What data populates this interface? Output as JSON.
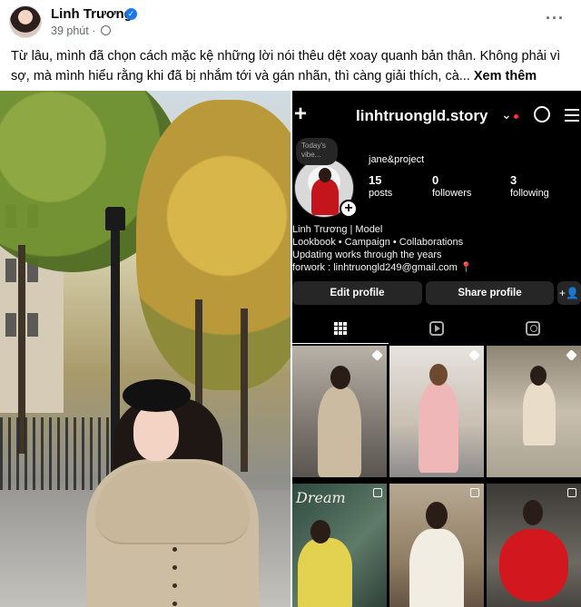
{
  "post": {
    "author": "Linh Trương",
    "verified_icon": "verified-badge-icon",
    "time": "39 phút",
    "dot": "·",
    "more_label": "···",
    "caption": "Từ lâu, mình đã chọn cách mặc kệ những lời nói thêu dệt xoay quanh bản thân. Không phải vì sợ, mà mình hiểu rằng khi đã bị nhắm tới và gán nhãn, thì càng giải thích, cà...",
    "see_more": "Xem thêm"
  },
  "instagram": {
    "username": "linhtruongld.story",
    "chevron": "⌄",
    "note": "Today's vibe...",
    "handle": "jane&project",
    "stats": [
      {
        "value": "15",
        "label": "posts"
      },
      {
        "value": "0",
        "label": "followers"
      },
      {
        "value": "3",
        "label": "following"
      }
    ],
    "bio": {
      "line1": "Linh Trương | Model",
      "line2": "Lookbook • Campaign • Collaborations",
      "line3": "Updating works through the years",
      "line4": "forwork : linhtruongld249@gmail.com",
      "pin": "📍"
    },
    "buttons": {
      "edit_profile": "Edit profile",
      "share_profile": "Share profile",
      "add_person": "+👤"
    },
    "add_story": "+",
    "plus": "+",
    "tabs": [
      "grid",
      "reels",
      "tagged"
    ],
    "dream_text": "Dream",
    "colors": {
      "background": "#000000",
      "button": "#262626",
      "notification_dot": "#ff3040"
    }
  },
  "colors": {
    "text_primary": "#050505",
    "text_secondary": "#65676b",
    "verified": "#1877f2"
  }
}
